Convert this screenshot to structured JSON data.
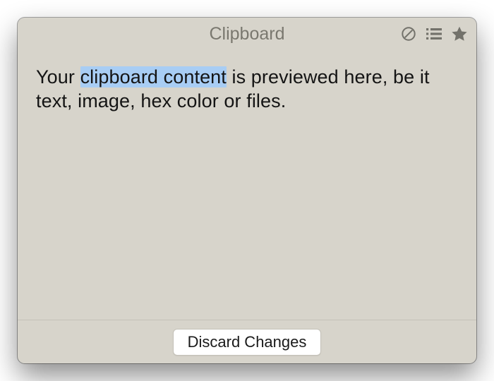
{
  "header": {
    "title": "Clipboard",
    "icons": {
      "clear": "clear-icon",
      "list": "list-icon",
      "star": "star-icon"
    }
  },
  "content": {
    "before_selection": "Your ",
    "selected": "clipboard content",
    "after_selection": " is previewed here, be it text, image, hex color or files."
  },
  "footer": {
    "discard_label": "Discard Changes"
  },
  "colors": {
    "window_bg": "#d7d4cb",
    "title_text": "#7a786f",
    "selection_bg": "#a8cdf4",
    "button_bg": "#ffffff"
  }
}
